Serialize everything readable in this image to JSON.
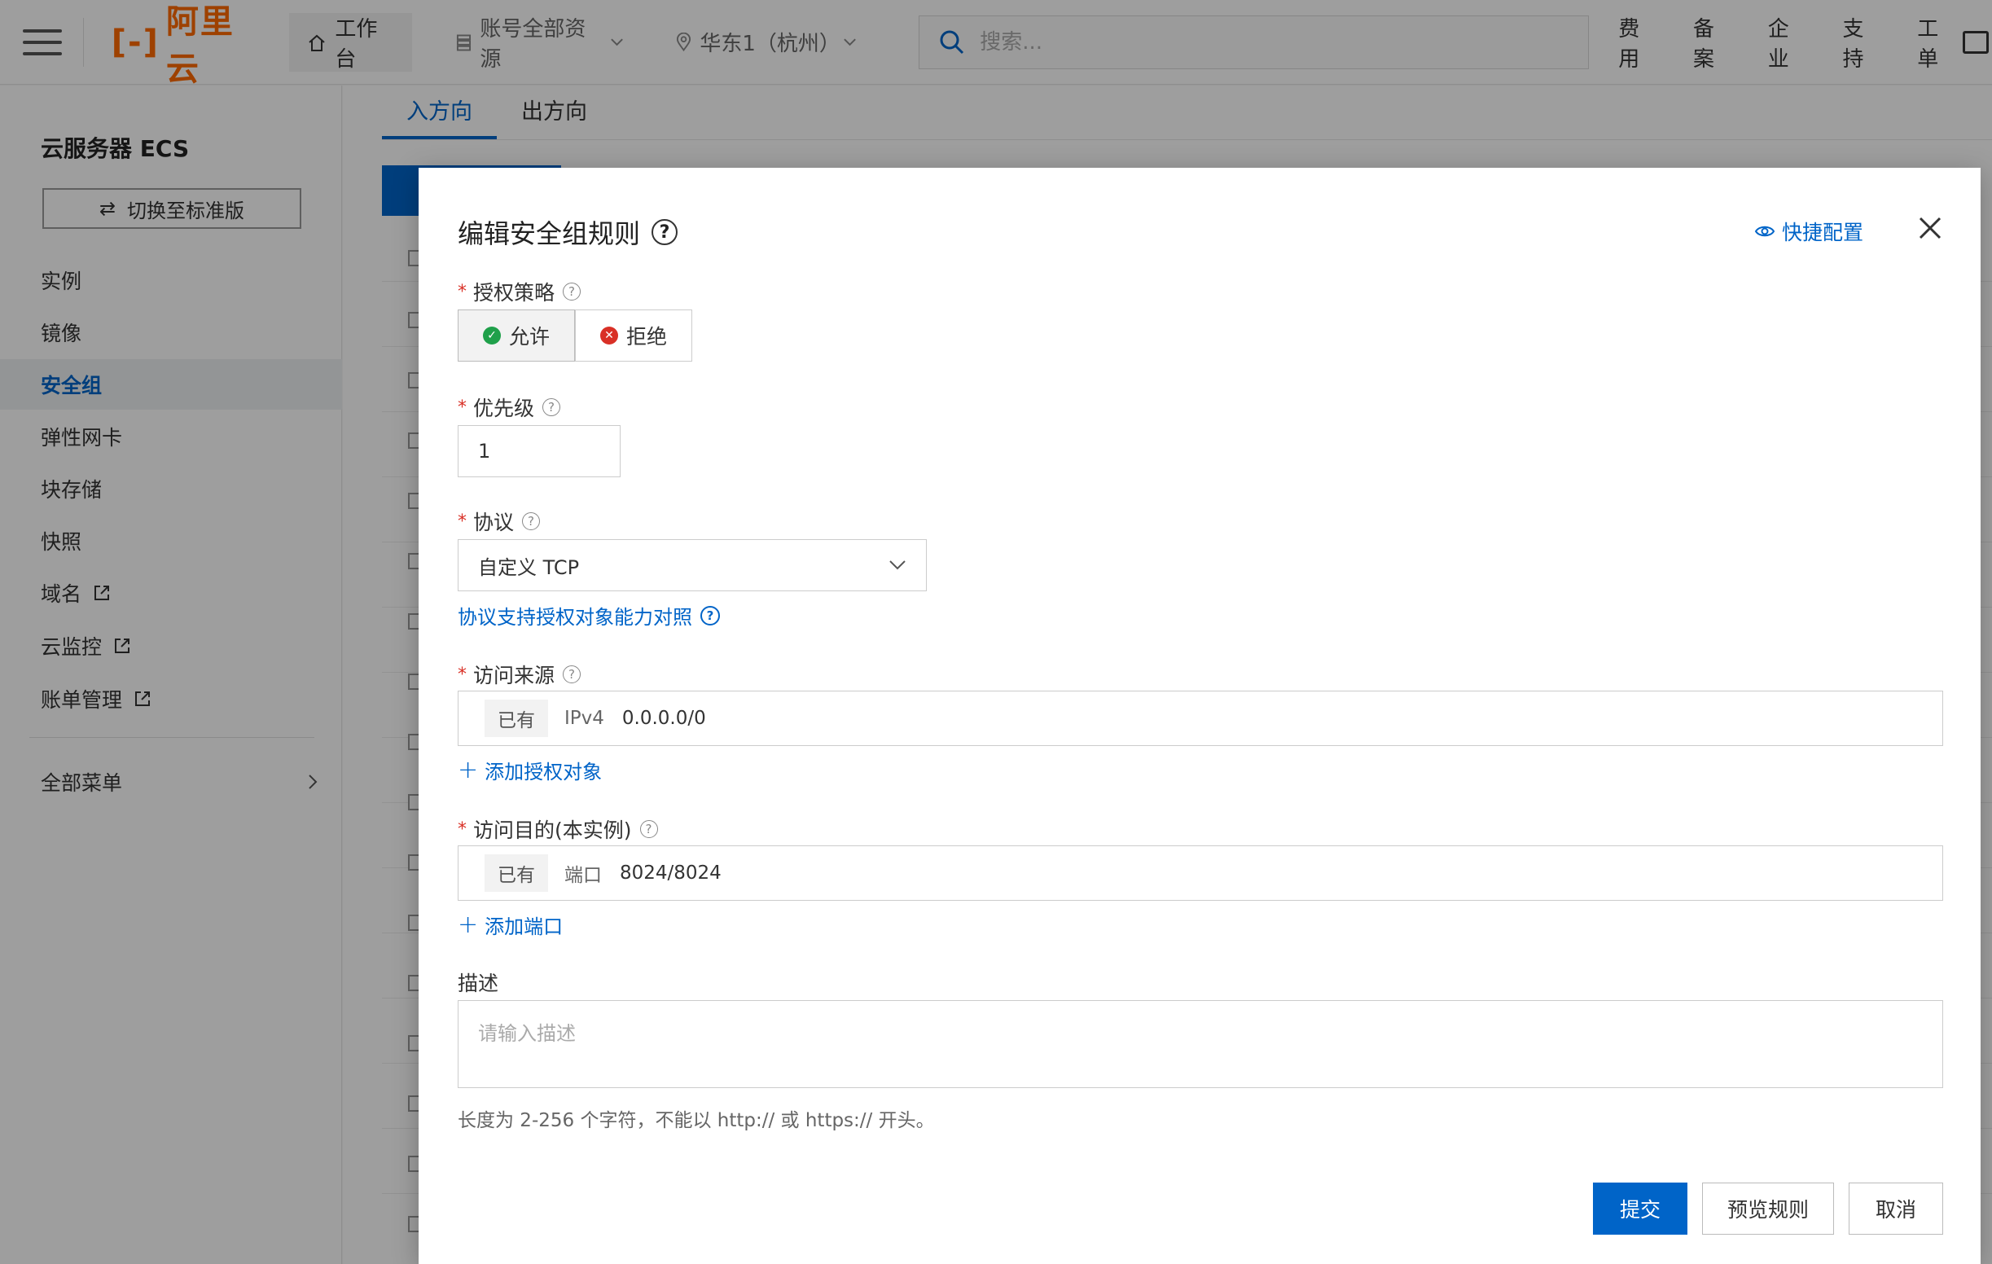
{
  "topbar": {
    "logo_text": "阿里云",
    "workbench": "工作台",
    "resource_scope": "账号全部资源",
    "region": "华东1（杭州）",
    "search_placeholder": "搜索...",
    "links": [
      "费用",
      "备案",
      "企业",
      "支持",
      "工单"
    ]
  },
  "sidebar": {
    "title": "云服务器 ECS",
    "switch_label": "切换至标准版",
    "items": [
      {
        "label": "实例",
        "external": false,
        "active": false
      },
      {
        "label": "镜像",
        "external": false,
        "active": false
      },
      {
        "label": "安全组",
        "external": false,
        "active": true
      },
      {
        "label": "弹性网卡",
        "external": false,
        "active": false
      },
      {
        "label": "块存储",
        "external": false,
        "active": false
      },
      {
        "label": "快照",
        "external": false,
        "active": false
      },
      {
        "label": "域名",
        "external": true,
        "active": false
      },
      {
        "label": "云监控",
        "external": true,
        "active": false
      },
      {
        "label": "账单管理",
        "external": true,
        "active": false
      }
    ],
    "all_menu": "全部菜单"
  },
  "main": {
    "tabs": [
      {
        "label": "入方向",
        "active": true
      },
      {
        "label": "出方向",
        "active": false
      }
    ]
  },
  "modal": {
    "title": "编辑安全组规则",
    "quick_config": "快捷配置",
    "policy": {
      "label": "授权策略",
      "options": [
        {
          "label": "允许",
          "selected": true,
          "color": "#1fa04a"
        },
        {
          "label": "拒绝",
          "selected": false,
          "color": "#d93026"
        }
      ]
    },
    "priority": {
      "label": "优先级",
      "value": "1"
    },
    "protocol": {
      "label": "协议",
      "value": "自定义 TCP",
      "support_link": "协议支持授权对象能力对照"
    },
    "source": {
      "label": "访问来源",
      "tag": "已有",
      "key": "IPv4",
      "value": "0.0.0.0/0",
      "add_link": "添加授权对象"
    },
    "destination": {
      "label": "访问目的(本实例)",
      "tag": "已有",
      "key": "端口",
      "value": "8024/8024",
      "add_link": "添加端口"
    },
    "description": {
      "label": "描述",
      "placeholder": "请输入描述",
      "hint": "长度为 2-256 个字符，不能以 http:// 或 https:// 开头。"
    },
    "buttons": {
      "submit": "提交",
      "preview": "预览规则",
      "cancel": "取消"
    }
  },
  "colors": {
    "accent": "#0064c8",
    "brand": "#ff6a00",
    "required": "#d93026"
  }
}
